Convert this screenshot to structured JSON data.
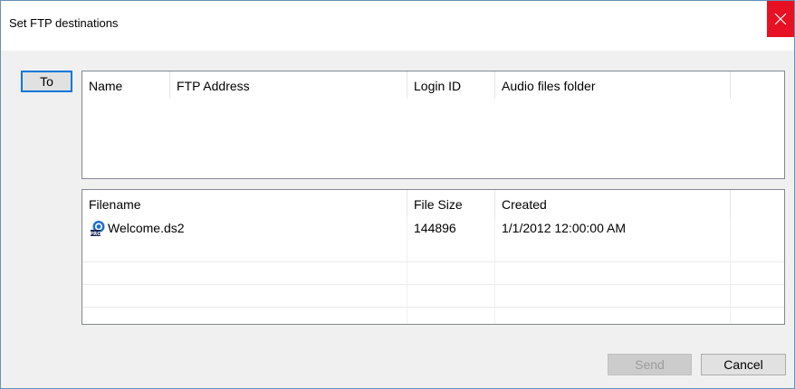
{
  "window": {
    "title": "Set FTP destinations"
  },
  "buttons": {
    "to_label": "To",
    "send_label": "Send",
    "cancel_label": "Cancel"
  },
  "destinations": {
    "columns": [
      "Name",
      "FTP Address",
      "Login ID",
      "Audio files folder"
    ],
    "rows": []
  },
  "files": {
    "columns": [
      "Filename",
      "File Size",
      "Created"
    ],
    "rows": [
      {
        "filename": "Welcome.ds2",
        "size": "144896",
        "created": "1/1/2012 12:00:00 AM",
        "icon": "dss-pro-file-icon"
      }
    ]
  },
  "colors": {
    "close_button": "#e81123",
    "default_button_border": "#0078d7",
    "file_icon_blue": "#1a6fd0"
  }
}
